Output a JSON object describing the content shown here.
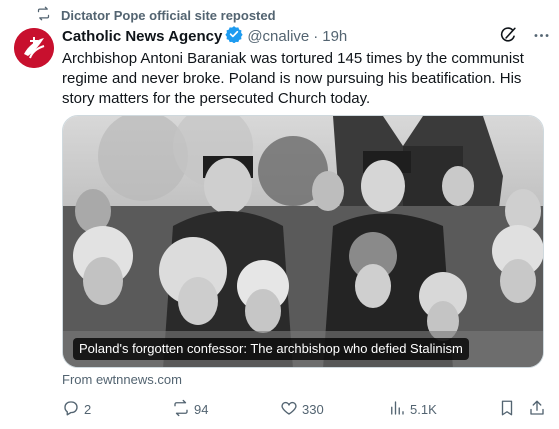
{
  "repost": {
    "text": "Dictator Pope official site reposted",
    "icon": "repost-icon"
  },
  "author": {
    "display_name": "Catholic News Agency",
    "handle": "@cnalive",
    "separator": "·",
    "time": "19h",
    "avatar_icon": "cna-logo-avatar",
    "avatar_color": "#c8102e",
    "verified_color": "#1d9bf0"
  },
  "tweet": {
    "text": "Archbishop Antoni Baraniak was tortured 145 times by the communist regime and never broke. Poland is now pursuing his beatification. His story matters for the persecuted Church today."
  },
  "media": {
    "caption": "Poland's forgotten confessor: The archbishop who defied Stalinism",
    "source": "From ewtnnews.com"
  },
  "actions": {
    "replies": "2",
    "reposts": "94",
    "likes": "330",
    "views": "5.1K"
  },
  "icons": [
    "repost-icon",
    "grok-icon",
    "more-icon",
    "reply-icon",
    "like-icon",
    "views-icon",
    "bookmark-icon",
    "share-icon"
  ],
  "colors": {
    "text": "#0f1419",
    "muted": "#536471",
    "border": "#cfd9de"
  }
}
